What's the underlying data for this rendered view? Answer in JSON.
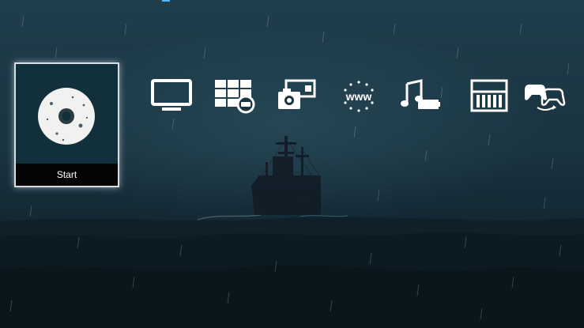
{
  "background": {
    "sky_top": "#20404f",
    "sky_mid": "#17313e",
    "sea": "#0b1a22",
    "rain": "#9fb6c2"
  },
  "accent_color": "#4fb7ff",
  "game_tile": {
    "label": "Start",
    "icon": "disc-icon",
    "selected": true
  },
  "xmb_icons": [
    {
      "name": "tv-icon",
      "category": "tv"
    },
    {
      "name": "windows-apps-icon",
      "category": "apps"
    },
    {
      "name": "camera-media-icon",
      "category": "photos"
    },
    {
      "name": "web-browser-icon",
      "category": "web"
    },
    {
      "name": "music-icon",
      "category": "music"
    },
    {
      "name": "library-icon",
      "category": "library"
    },
    {
      "name": "game-controllers-icon",
      "category": "games"
    }
  ]
}
